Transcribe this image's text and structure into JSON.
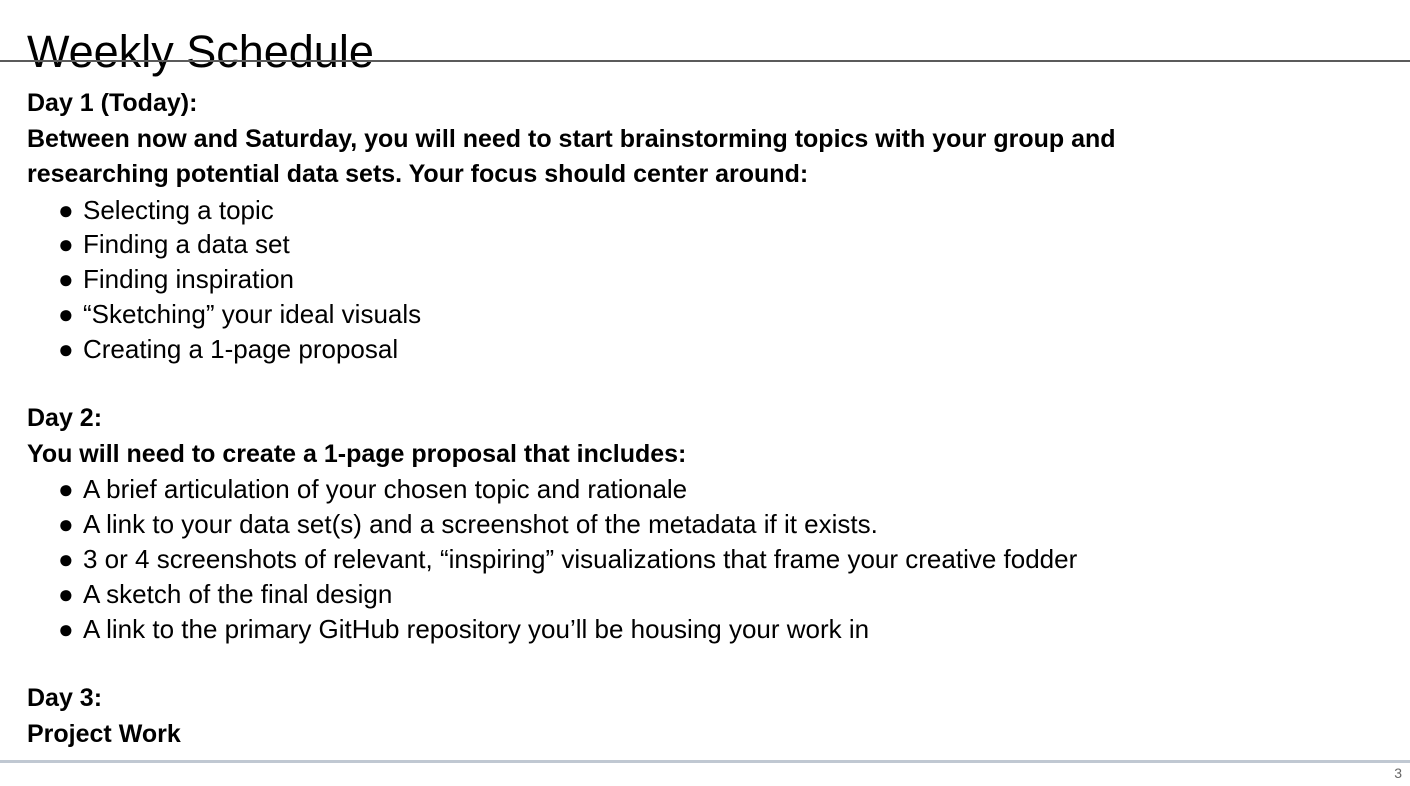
{
  "slide": {
    "title": "Weekly Schedule",
    "page_number": "3",
    "rule_colors": {
      "header": "#5b5b5b",
      "footer": "#c0c8d2"
    },
    "bullet_glyph": "●"
  },
  "sections": [
    {
      "heading": "Day 1 (Today):",
      "lead": "Between now and Saturday, you will need to start brainstorming topics with your group and researching potential data sets. Your focus should center around:",
      "bullets": [
        "Selecting a topic",
        "Finding a data set",
        "Finding inspiration",
        "“Sketching” your ideal visuals",
        "Creating a 1-page proposal"
      ]
    },
    {
      "heading": "Day 2:",
      "lead": "You will need to create a 1-page proposal that includes:",
      "bullets": [
        "A brief articulation of your chosen topic and rationale",
        "A link to your data set(s) and a screenshot of the metadata if it exists.",
        "3 or 4 screenshots of relevant, “inspiring” visualizations that frame your creative fodder",
        "A sketch of the final design",
        "A link to the primary GitHub repository you’ll be housing your work in"
      ]
    },
    {
      "heading": "Day 3:",
      "lead": "Project Work",
      "bullets": []
    }
  ]
}
